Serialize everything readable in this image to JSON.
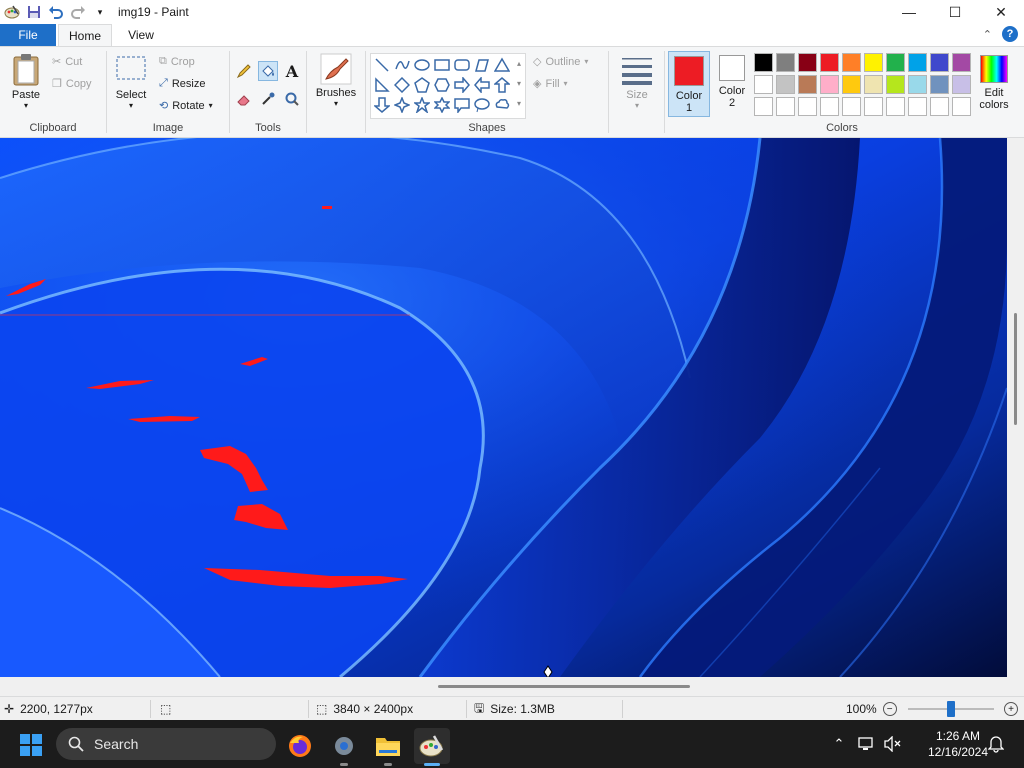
{
  "window": {
    "title": "img19 - Paint",
    "controls": {
      "minimize": "—",
      "maximize": "☐",
      "close": "✕"
    }
  },
  "tabs": {
    "file": "File",
    "home": "Home",
    "view": "View",
    "help": "?"
  },
  "ribbon": {
    "clipboard": {
      "label": "Clipboard",
      "paste": "Paste",
      "cut": "Cut",
      "copy": "Copy"
    },
    "image": {
      "label": "Image",
      "select": "Select",
      "crop": "Crop",
      "resize": "Resize",
      "rotate": "Rotate"
    },
    "tools": {
      "label": "Tools"
    },
    "brushes": {
      "label": "Brushes"
    },
    "shapes": {
      "label": "Shapes",
      "outline": "Outline",
      "fill": "Fill"
    },
    "size": {
      "label": "Size"
    },
    "colors": {
      "label": "Colors",
      "color1": "Color",
      "color1_num": "1",
      "color2": "Color",
      "color2_num": "2",
      "edit": "Edit",
      "edit2": "colors",
      "color1_value": "#ed1c24",
      "color2_value": "#ffffff",
      "palette_row1": [
        "#000000",
        "#7f7f7f",
        "#880015",
        "#ed1c24",
        "#ff7f27",
        "#fff200",
        "#22b14c",
        "#00a2e8",
        "#3f48cc",
        "#a349a4"
      ],
      "palette_row2": [
        "#ffffff",
        "#c3c3c3",
        "#b97a57",
        "#ffaec9",
        "#ffc90e",
        "#efe4b0",
        "#b5e61d",
        "#99d9ea",
        "#7092be",
        "#c8bfe7"
      ]
    }
  },
  "status": {
    "cursor_pos": "2200, 1277px",
    "image_size": "3840 × 2400px",
    "file_size": "Size: 1.3MB",
    "zoom": "100%",
    "zoom_fraction": 0.5
  },
  "taskbar": {
    "search": "Search",
    "time": "1:26 AM",
    "date": "12/16/2024"
  }
}
